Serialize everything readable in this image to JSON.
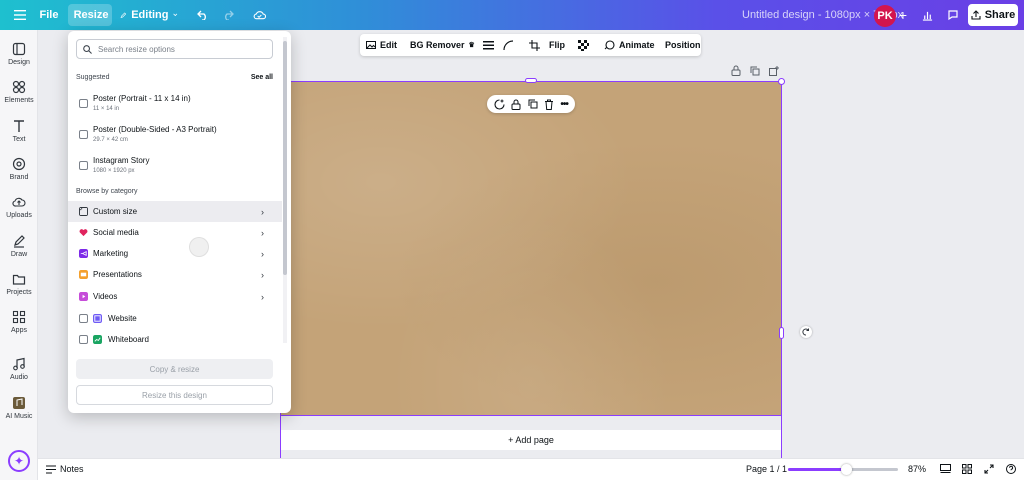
{
  "topbar": {
    "file_label": "File",
    "resize_label": "Resize",
    "editing_label": "Editing",
    "title": "Untitled design - 1080px × 720px",
    "avatar_initials": "PK",
    "share_label": "Share",
    "icons": [
      "menu-icon",
      "resize-icon",
      "pencil-icon",
      "undo-icon",
      "redo-icon",
      "cloud-icon",
      "plus-icon",
      "analytics-icon",
      "comment-icon",
      "share-icon"
    ]
  },
  "rail": {
    "items": [
      {
        "label": "Design",
        "icon": "design-icon"
      },
      {
        "label": "Elements",
        "icon": "elements-icon"
      },
      {
        "label": "Text",
        "icon": "text-icon"
      },
      {
        "label": "Brand",
        "icon": "brand-icon"
      },
      {
        "label": "Uploads",
        "icon": "uploads-icon"
      },
      {
        "label": "Draw",
        "icon": "draw-icon"
      },
      {
        "label": "Projects",
        "icon": "projects-icon"
      },
      {
        "label": "Apps",
        "icon": "apps-icon"
      },
      {
        "label": "Audio",
        "icon": "audio-icon"
      },
      {
        "label": "AI Music",
        "icon": "ai-music-icon"
      }
    ]
  },
  "contextbar": {
    "edit": "Edit",
    "bg_remover": "BG Remover",
    "flip": "Flip",
    "animate": "Animate",
    "position": "Position"
  },
  "canvas": {
    "add_page": "+ Add page",
    "background_color": "#c4a378",
    "selection_color": "#8b3dff"
  },
  "bottombar": {
    "notes": "Notes",
    "page_indicator": "Page 1 / 1",
    "zoom": "87%",
    "zoom_fraction": 0.53
  },
  "resize_panel": {
    "search_placeholder": "Search resize options",
    "suggested_label": "Suggested",
    "see_all": "See all",
    "suggestions": [
      {
        "title": "Poster (Portrait - 11 x 14 in)",
        "size": "11 × 14 in"
      },
      {
        "title": "Poster (Double-Sided - A3 Portrait)",
        "size": "29.7 × 42 cm"
      },
      {
        "title": "Instagram Story",
        "size": "1080 × 1920 px"
      }
    ],
    "browse_label": "Browse by category",
    "categories": [
      {
        "label": "Custom size",
        "icon": "custom-size-icon",
        "color": "#30363d"
      },
      {
        "label": "Social media",
        "icon": "social-media-icon",
        "color": "#e0245e"
      },
      {
        "label": "Marketing",
        "icon": "marketing-icon",
        "color": "#7d2ae8"
      },
      {
        "label": "Presentations",
        "icon": "presentations-icon",
        "color": "#f4a02d"
      },
      {
        "label": "Videos",
        "icon": "videos-icon",
        "color": "#c64dd9"
      }
    ],
    "checkables": [
      {
        "label": "Website",
        "icon": "website-icon",
        "color": "#6f5bf5"
      },
      {
        "label": "Whiteboard",
        "icon": "whiteboard-icon",
        "color": "#1aa562"
      }
    ],
    "copy_resize": "Copy & resize",
    "resize_this": "Resize this design"
  }
}
